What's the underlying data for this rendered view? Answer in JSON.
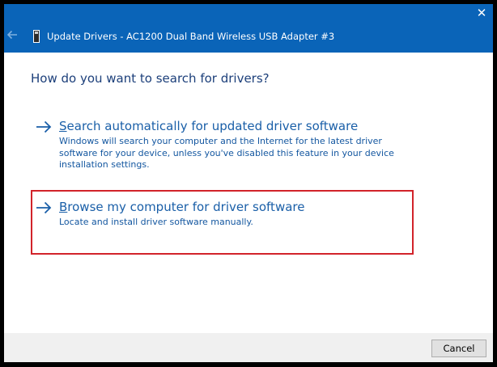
{
  "window": {
    "title": "Update Drivers - AC1200  Dual Band Wireless USB Adapter #3",
    "close_glyph": "✕",
    "back_icon": "back-arrow-icon",
    "device_icon": "usb-adapter-icon",
    "colors": {
      "titlebar": "#0a64b8",
      "link": "#1a5fa8",
      "heading": "#1c3f7a",
      "highlight": "#d2232a"
    }
  },
  "main": {
    "heading": "How do you want to search for drivers?",
    "options": [
      {
        "title_accel": "S",
        "title_rest": "earch automatically for updated driver software",
        "description": "Windows will search your computer and the Internet for the latest driver software for your device, unless you've disabled this feature in your device installation settings.",
        "icon": "arrow-right-icon"
      },
      {
        "title_accel": "B",
        "title_rest": "rowse my computer for driver software",
        "description": "Locate and install driver software manually.",
        "icon": "arrow-right-icon",
        "highlighted": true
      }
    ]
  },
  "footer": {
    "cancel_label": "Cancel"
  }
}
